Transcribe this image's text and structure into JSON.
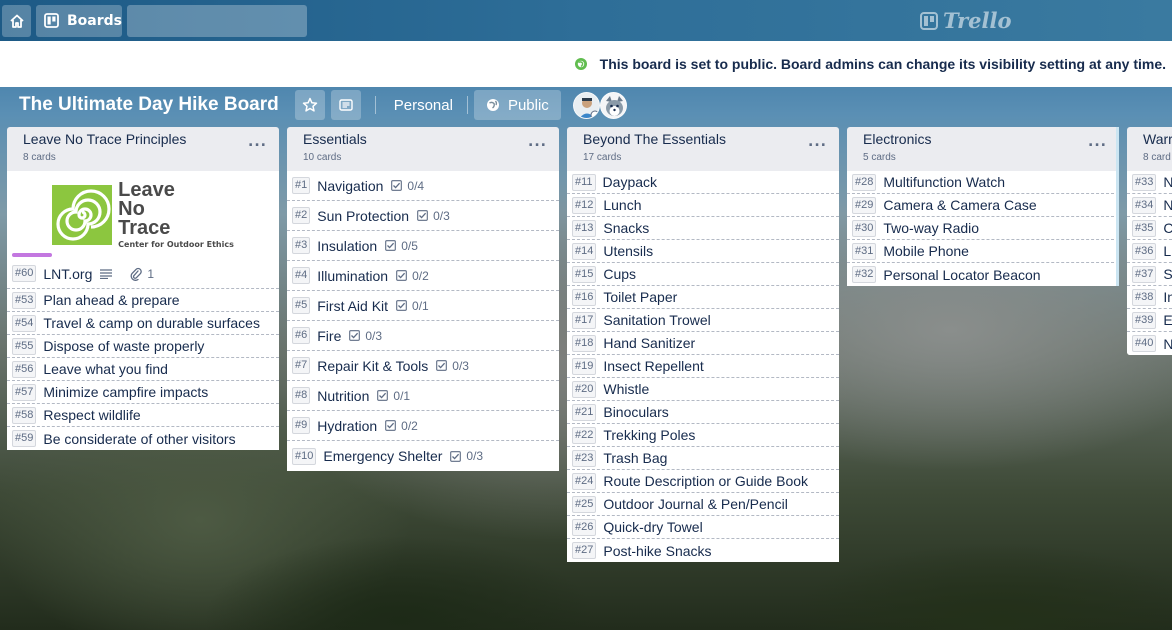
{
  "header": {
    "boards_label": "Boards",
    "search_placeholder": "",
    "logo_text": "Trello"
  },
  "banner": {
    "message": "This board is set to public. Board admins can change its visibility setting at any time."
  },
  "board": {
    "title": "The Ultimate Day Hike Board",
    "team_label": "Personal",
    "visibility_label": "Public"
  },
  "lists": [
    {
      "name": "Leave No Trace Principles",
      "count": "8 cards",
      "cover": {
        "line1": "Leave",
        "line2": "No",
        "line3": "Trace",
        "tm": "™",
        "sub": "Center for Outdoor Ethics"
      },
      "cards": [
        {
          "num": "#60",
          "title": "LNT.org",
          "attach": "1"
        },
        {
          "num": "#53",
          "title": "Plan ahead & prepare"
        },
        {
          "num": "#54",
          "title": "Travel & camp on durable surfaces"
        },
        {
          "num": "#55",
          "title": "Dispose of waste properly"
        },
        {
          "num": "#56",
          "title": "Leave what you find"
        },
        {
          "num": "#57",
          "title": "Minimize campfire impacts"
        },
        {
          "num": "#58",
          "title": "Respect wildlife"
        },
        {
          "num": "#59",
          "title": "Be considerate of other visitors"
        }
      ]
    },
    {
      "name": "Essentials",
      "count": "10 cards",
      "cards": [
        {
          "num": "#1",
          "title": "Navigation",
          "check": "0/4"
        },
        {
          "num": "#2",
          "title": "Sun Protection",
          "check": "0/3"
        },
        {
          "num": "#3",
          "title": "Insulation",
          "check": "0/5"
        },
        {
          "num": "#4",
          "title": "Illumination",
          "check": "0/2"
        },
        {
          "num": "#5",
          "title": "First Aid Kit",
          "check": "0/1"
        },
        {
          "num": "#6",
          "title": "Fire",
          "check": "0/3"
        },
        {
          "num": "#7",
          "title": "Repair Kit & Tools",
          "check": "0/3"
        },
        {
          "num": "#8",
          "title": "Nutrition",
          "check": "0/1"
        },
        {
          "num": "#9",
          "title": "Hydration",
          "check": "0/2"
        },
        {
          "num": "#10",
          "title": "Emergency Shelter",
          "check": "0/3"
        }
      ]
    },
    {
      "name": "Beyond The Essentials",
      "count": "17 cards",
      "cards": [
        {
          "num": "#11",
          "title": "Daypack"
        },
        {
          "num": "#12",
          "title": "Lunch"
        },
        {
          "num": "#13",
          "title": "Snacks"
        },
        {
          "num": "#14",
          "title": "Utensils"
        },
        {
          "num": "#15",
          "title": "Cups"
        },
        {
          "num": "#16",
          "title": "Toilet Paper"
        },
        {
          "num": "#17",
          "title": "Sanitation Trowel"
        },
        {
          "num": "#18",
          "title": "Hand Sanitizer"
        },
        {
          "num": "#19",
          "title": "Insect Repellent"
        },
        {
          "num": "#20",
          "title": "Whistle"
        },
        {
          "num": "#21",
          "title": "Binoculars"
        },
        {
          "num": "#22",
          "title": "Trekking Poles"
        },
        {
          "num": "#23",
          "title": "Trash Bag"
        },
        {
          "num": "#24",
          "title": "Route Description or Guide Book"
        },
        {
          "num": "#25",
          "title": "Outdoor Journal & Pen/Pencil"
        },
        {
          "num": "#26",
          "title": "Quick-dry Towel"
        },
        {
          "num": "#27",
          "title": "Post-hike Snacks"
        }
      ]
    },
    {
      "name": "Electronics",
      "count": "5 cards",
      "cards": [
        {
          "num": "#28",
          "title": "Multifunction Watch"
        },
        {
          "num": "#29",
          "title": "Camera & Camera Case"
        },
        {
          "num": "#30",
          "title": "Two-way Radio"
        },
        {
          "num": "#31",
          "title": "Mobile Phone"
        },
        {
          "num": "#32",
          "title": "Personal Locator Beacon"
        }
      ]
    },
    {
      "name": "Warr",
      "count": "8 card",
      "cards": [
        {
          "num": "#33",
          "title": "N"
        },
        {
          "num": "#34",
          "title": "N"
        },
        {
          "num": "#35",
          "title": "C"
        },
        {
          "num": "#36",
          "title": "L"
        },
        {
          "num": "#37",
          "title": "S"
        },
        {
          "num": "#38",
          "title": "In"
        },
        {
          "num": "#39",
          "title": "E"
        },
        {
          "num": "#40",
          "title": "N"
        }
      ]
    }
  ],
  "list_menu_label": "..."
}
